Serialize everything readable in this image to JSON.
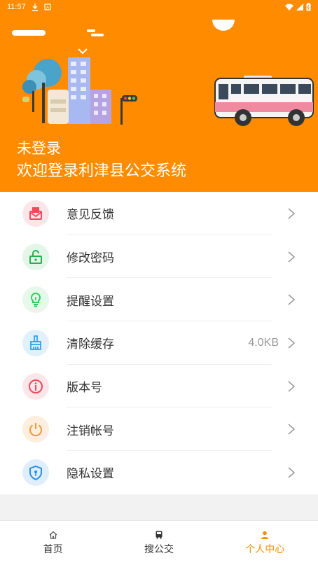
{
  "status_bar": {
    "time": "11:57"
  },
  "header": {
    "login_status": "未登录",
    "welcome": "欢迎登录利津县公交系统"
  },
  "menu": [
    {
      "label": "意见反馈",
      "icon": "feedback-mail-icon",
      "color": "#ef4a5b",
      "bg": "#fde6ea"
    },
    {
      "label": "修改密码",
      "icon": "unlock-icon",
      "color": "#22b14c",
      "bg": "#e3f6e8"
    },
    {
      "label": "提醒设置",
      "icon": "bulb-icon",
      "color": "#2ecb5a",
      "bg": "#e5f8ea"
    },
    {
      "label": "清除缓存",
      "icon": "brush-icon",
      "color": "#2aa7e8",
      "bg": "#e1f1fb",
      "value": "4.0KB"
    },
    {
      "label": "版本号",
      "icon": "info-icon",
      "color": "#ef4a5b",
      "bg": "#fde6ea"
    },
    {
      "label": "注销帐号",
      "icon": "power-icon",
      "color": "#f39a3a",
      "bg": "#fdeedd"
    },
    {
      "label": "隐私设置",
      "icon": "shield-icon",
      "color": "#2a8fe0",
      "bg": "#e0eefb"
    }
  ],
  "nav": [
    {
      "label": "首页",
      "icon": "home-icon",
      "active": false
    },
    {
      "label": "搜公交",
      "icon": "bus-icon",
      "active": false
    },
    {
      "label": "个人中心",
      "icon": "person-icon",
      "active": true
    }
  ],
  "colors": {
    "accent": "#ff8c00"
  }
}
